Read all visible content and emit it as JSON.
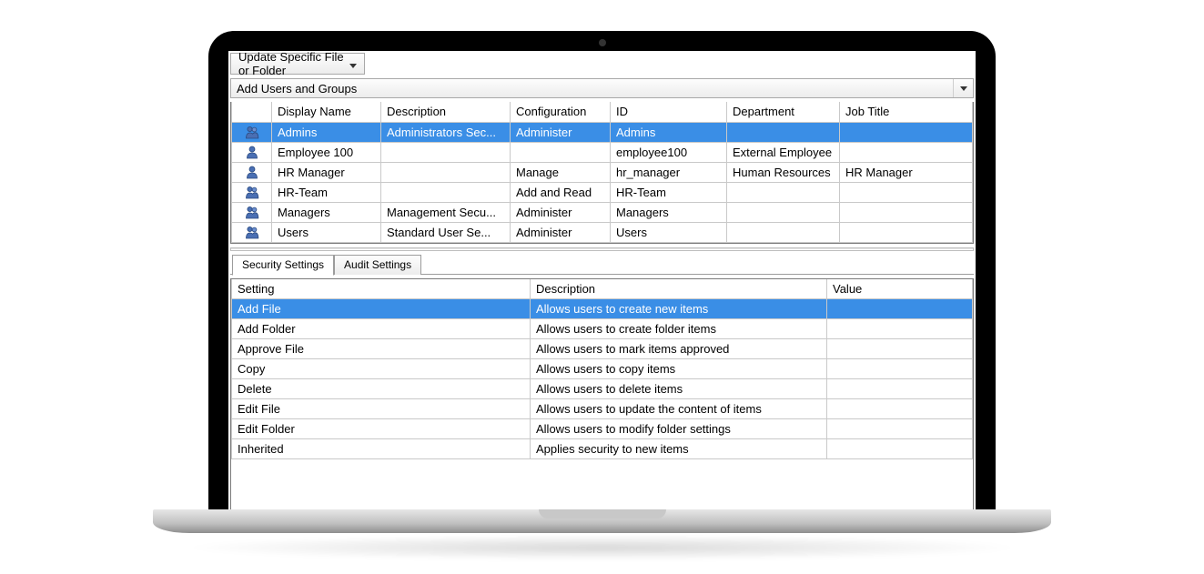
{
  "toolbar": {
    "scope_dropdown_label": "Update Specific File or Folder",
    "add_users_label": "Add Users and Groups"
  },
  "users_grid": {
    "columns": {
      "display_name": "Display Name",
      "description": "Description",
      "configuration": "Configuration",
      "id": "ID",
      "department": "Department",
      "job_title": "Job Title"
    },
    "rows": [
      {
        "icon": "group-icon",
        "selected": true,
        "display_name": "Admins",
        "description": "Administrators Sec...",
        "configuration": "Administer",
        "id": "Admins",
        "department": "",
        "job_title": ""
      },
      {
        "icon": "user-icon",
        "selected": false,
        "display_name": "Employee 100",
        "description": "",
        "configuration": "",
        "id": "employee100",
        "department": "External Employee",
        "job_title": ""
      },
      {
        "icon": "user-icon",
        "selected": false,
        "display_name": "HR Manager",
        "description": "",
        "configuration": "Manage",
        "id": "hr_manager",
        "department": "Human Resources",
        "job_title": "HR Manager"
      },
      {
        "icon": "group-icon",
        "selected": false,
        "display_name": "HR-Team",
        "description": "",
        "configuration": "Add and Read",
        "id": "HR-Team",
        "department": "",
        "job_title": ""
      },
      {
        "icon": "group-icon",
        "selected": false,
        "display_name": "Managers",
        "description": "Management Secu...",
        "configuration": "Administer",
        "id": "Managers",
        "department": "",
        "job_title": ""
      },
      {
        "icon": "group-icon",
        "selected": false,
        "display_name": "Users",
        "description": "Standard User Se...",
        "configuration": "Administer",
        "id": "Users",
        "department": "",
        "job_title": ""
      }
    ]
  },
  "tabs": {
    "security": "Security Settings",
    "audit": "Audit Settings",
    "active": "security"
  },
  "settings_grid": {
    "columns": {
      "setting": "Setting",
      "description": "Description",
      "value": "Value"
    },
    "rows": [
      {
        "selected": true,
        "setting": "Add File",
        "description": "Allows users to create new items",
        "value": ""
      },
      {
        "selected": false,
        "setting": "Add Folder",
        "description": "Allows users to create folder items",
        "value": ""
      },
      {
        "selected": false,
        "setting": "Approve File",
        "description": "Allows users to mark items approved",
        "value": ""
      },
      {
        "selected": false,
        "setting": "Copy",
        "description": "Allows users to copy items",
        "value": ""
      },
      {
        "selected": false,
        "setting": "Delete",
        "description": "Allows users to delete items",
        "value": ""
      },
      {
        "selected": false,
        "setting": "Edit File",
        "description": "Allows users to update the content of items",
        "value": ""
      },
      {
        "selected": false,
        "setting": "Edit Folder",
        "description": "Allows users to modify folder settings",
        "value": ""
      },
      {
        "selected": false,
        "setting": "Inherited",
        "description": "Applies security to new items",
        "value": ""
      }
    ]
  }
}
